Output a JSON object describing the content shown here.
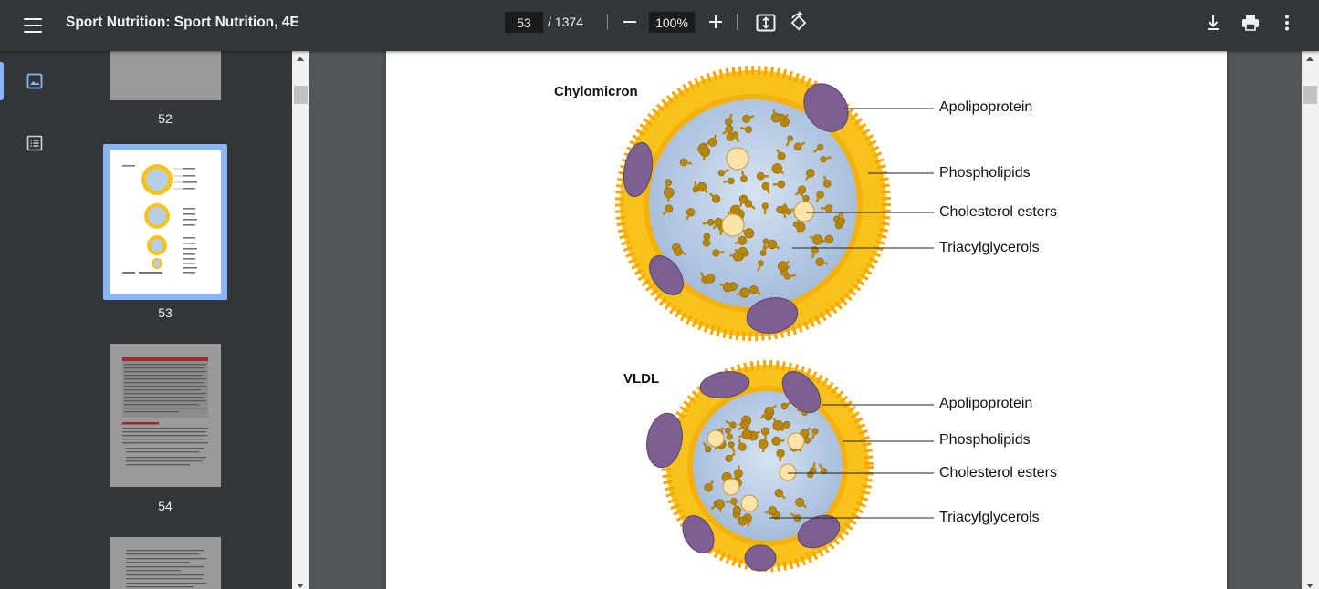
{
  "toolbar": {
    "title": "Sport Nutrition: Sport Nutrition, 4E",
    "current_page": "53",
    "total_pages": "/ 1374",
    "zoom": "100%",
    "icons": [
      "menu-icon",
      "minus-icon",
      "plus-icon",
      "fit-page-icon",
      "rotate-icon",
      "download-icon",
      "print-icon",
      "more-vert-icon"
    ]
  },
  "sidebar": {
    "tabs": [
      "thumbnails-icon",
      "outline-icon"
    ],
    "thumbnails": [
      {
        "label": "52"
      },
      {
        "label": "53"
      },
      {
        "label": "54"
      }
    ]
  },
  "figure": {
    "sections": [
      {
        "title": "Chylomicron",
        "labels": [
          "Apolipoprotein",
          "Phospholipids",
          "Cholesterol esters",
          "Triacylglycerols"
        ]
      },
      {
        "title": "VLDL",
        "labels": [
          "Apolipoprotein",
          "Phospholipids",
          "Cholesterol esters",
          "Triacylglycerols"
        ]
      }
    ]
  },
  "colors": {
    "toolbar_bg": "#323639",
    "viewer_bg": "#525659",
    "accent": "#8ab4f8",
    "shell_yellow": "#f7c21a",
    "core_blue": "#b8cde6",
    "protein_purple": "#7d5f92",
    "lipid_brown": "#b8860b"
  }
}
